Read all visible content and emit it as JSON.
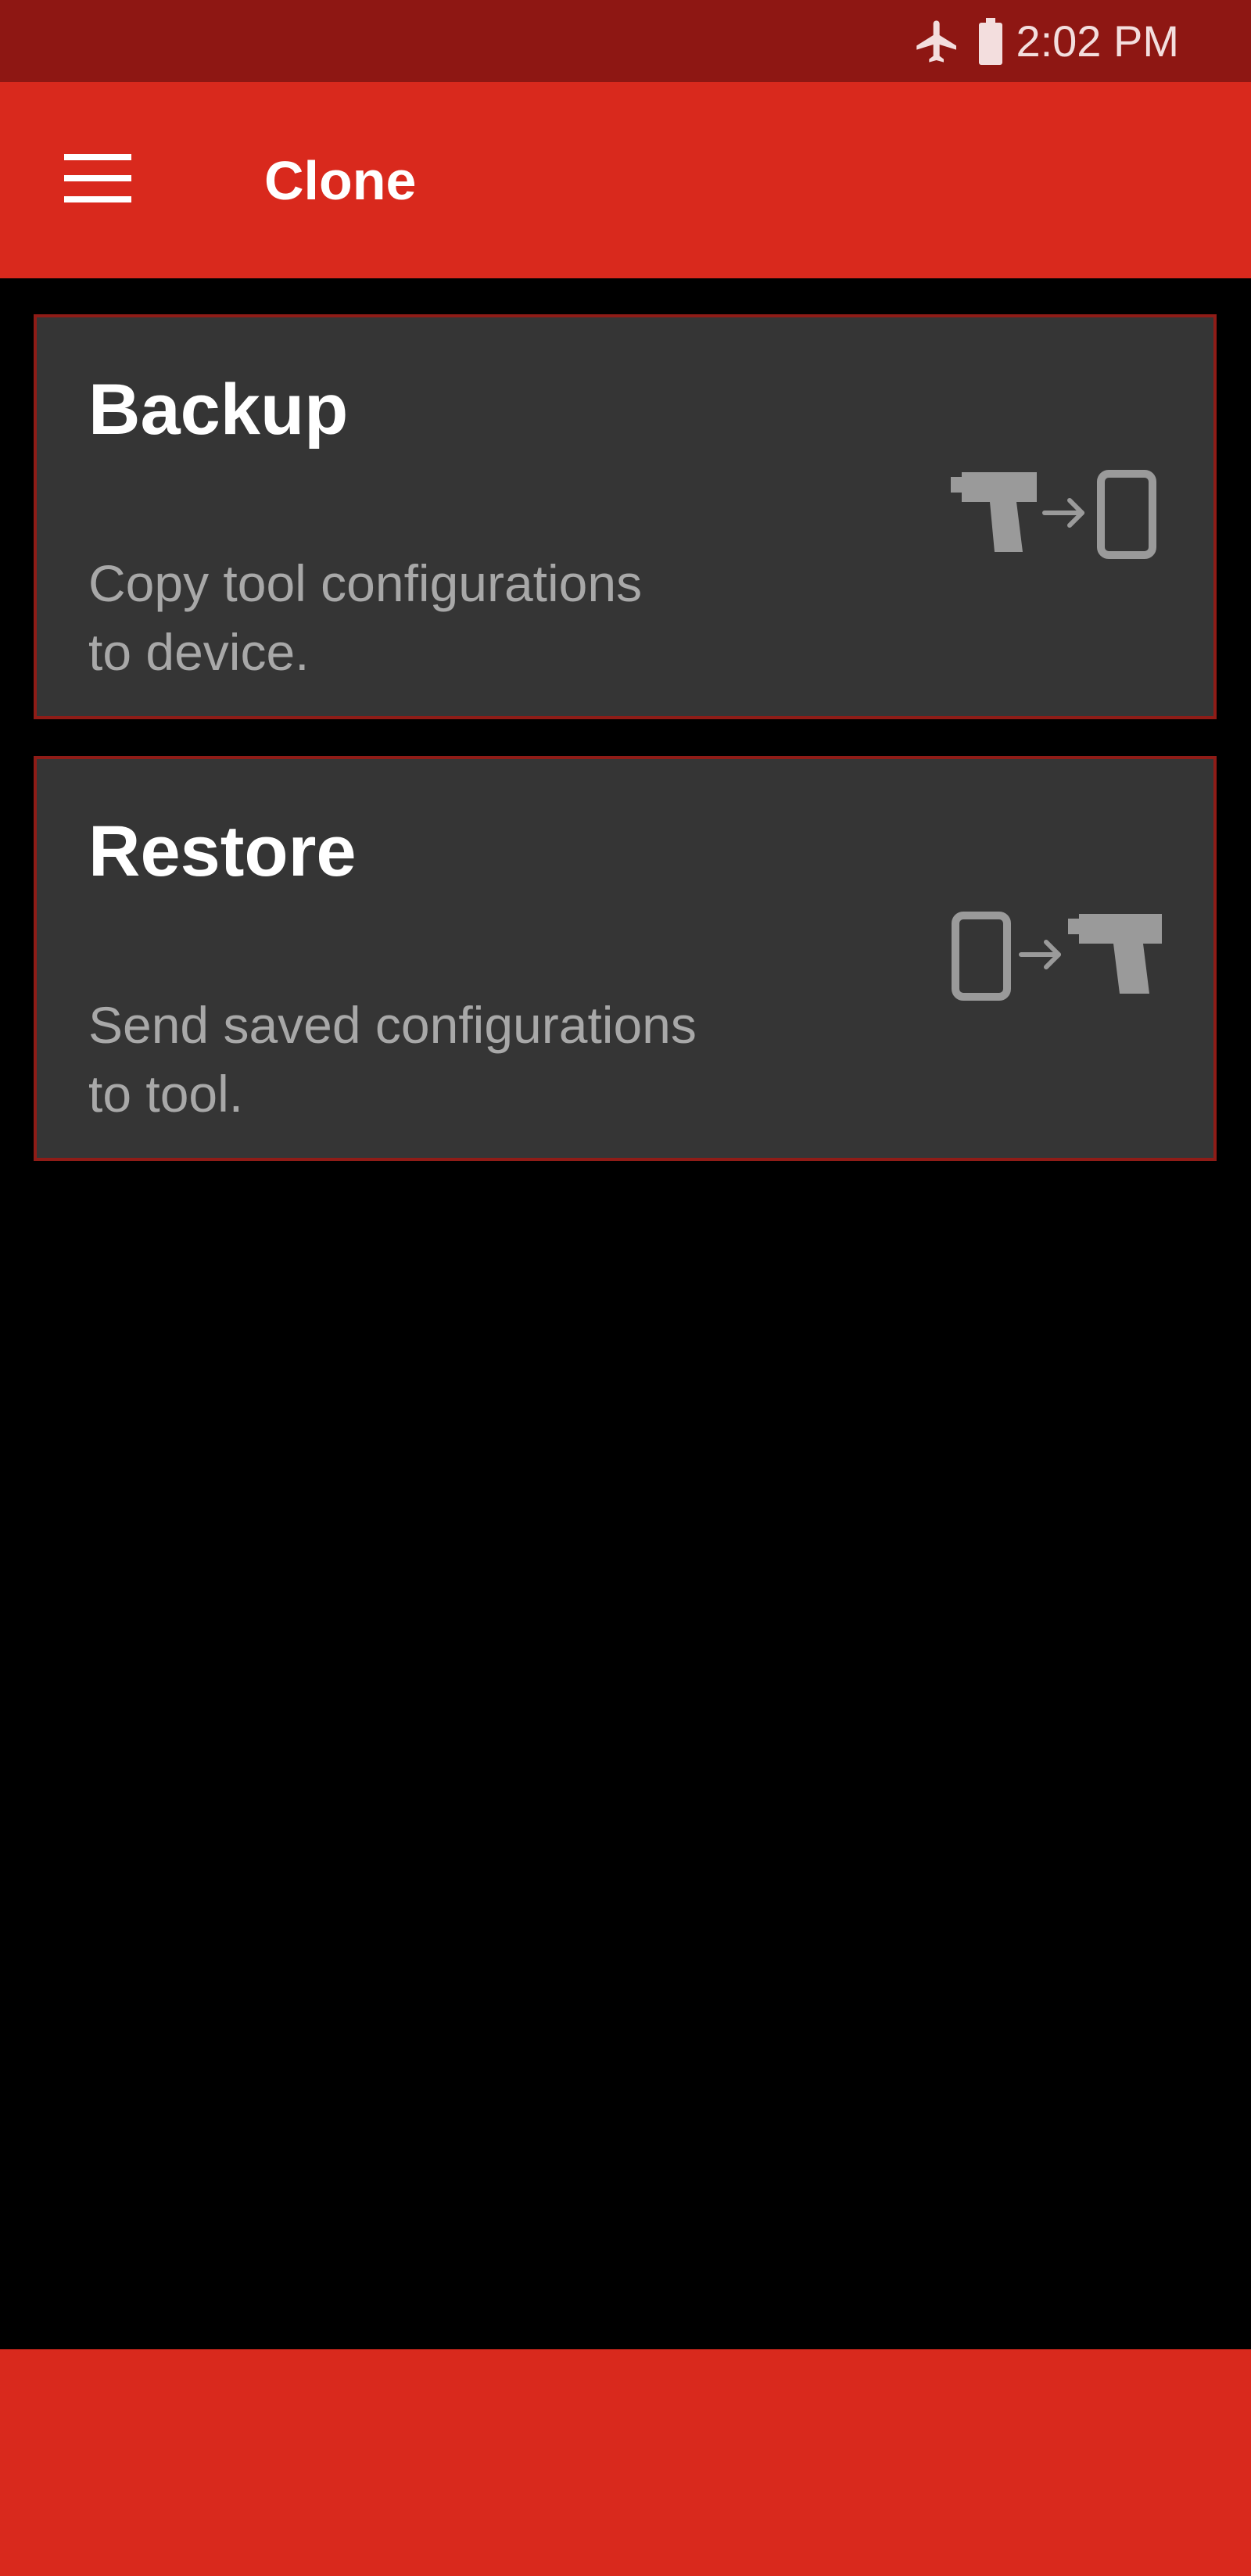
{
  "status_bar": {
    "time": "2:02 PM",
    "icons": [
      "airplane-mode-icon",
      "battery-icon"
    ]
  },
  "app_bar": {
    "title": "Clone",
    "menu_icon": "hamburger-menu-icon"
  },
  "cards": [
    {
      "title": "Backup",
      "description_line1": "Copy tool configurations",
      "description_line2": "to device.",
      "icon": "tool-to-device-icon"
    },
    {
      "title": "Restore",
      "description_line1": "Send saved configurations",
      "description_line2": "to tool.",
      "icon": "device-to-tool-icon"
    }
  ],
  "colors": {
    "status_bar": "#8e1713",
    "app_bar": "#d9291d",
    "card_bg": "#353535",
    "card_border": "#8f1c17",
    "background": "#000000",
    "icon_gray": "#9a9a9a"
  }
}
